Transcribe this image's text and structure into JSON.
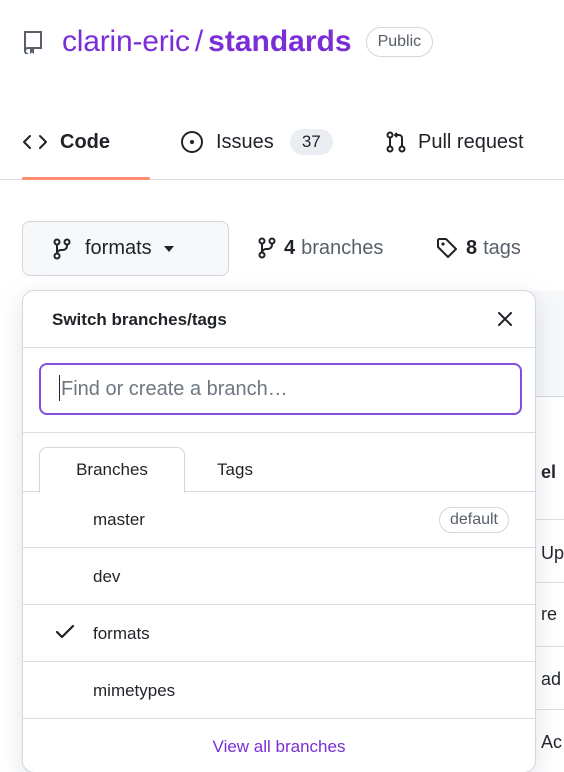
{
  "repo": {
    "owner": "clarin-eric",
    "separator": "/",
    "name": "standards",
    "visibility": "Public"
  },
  "tabs": [
    {
      "label": "Code",
      "icon": "code-icon",
      "active": true
    },
    {
      "label": "Issues",
      "icon": "issue-opened-icon",
      "count": "37"
    },
    {
      "label": "Pull request",
      "icon": "git-pull-request-icon"
    }
  ],
  "branch_bar": {
    "current_branch": "formats",
    "branches_count": "4",
    "branches_label": "branches",
    "tags_count": "8",
    "tags_label": "tags"
  },
  "background_rows": [
    "el",
    "Up",
    "re",
    "ad",
    "Ac"
  ],
  "dropdown": {
    "title": "Switch branches/tags",
    "filter_placeholder": "Find or create a branch…",
    "tabs": [
      "Branches",
      "Tags"
    ],
    "branches": [
      {
        "name": "master",
        "badge": "default",
        "selected": false
      },
      {
        "name": "dev",
        "badge": "",
        "selected": false
      },
      {
        "name": "formats",
        "badge": "",
        "selected": true
      },
      {
        "name": "mimetypes",
        "badge": "",
        "selected": false
      }
    ],
    "footer_link": "View all branches"
  },
  "colors": {
    "accent": "#7a2fd6",
    "tab_underline": "#fd8c73",
    "focus_border": "#8250df"
  }
}
